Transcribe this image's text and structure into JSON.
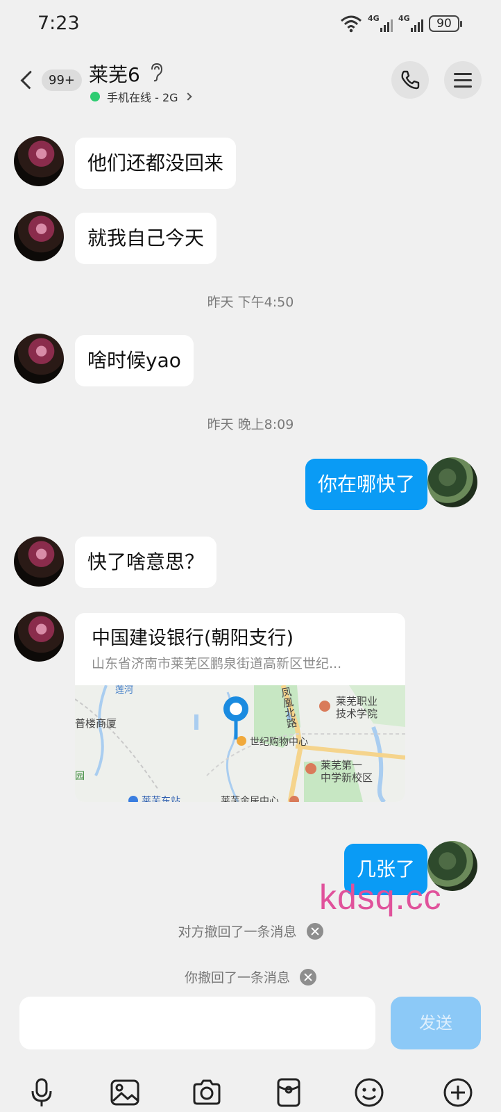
{
  "status_bar": {
    "time": "7:23",
    "signal1_label": "4G",
    "signal2_label": "4G",
    "battery": "90"
  },
  "header": {
    "unread_badge": "99+",
    "contact_name": "莱芜6",
    "online_status": "手机在线 - 2G"
  },
  "messages": [
    {
      "side": "in",
      "text": "他们还都没回来"
    },
    {
      "side": "in",
      "text": "就我自己今天"
    },
    {
      "side": "time",
      "text": "昨天 下午4:50"
    },
    {
      "side": "in",
      "text": "啥时候yao"
    },
    {
      "side": "time",
      "text": "昨天 晚上8:09"
    },
    {
      "side": "out",
      "text": "你在哪快了"
    },
    {
      "side": "in",
      "text": "快了啥意思？"
    },
    {
      "side": "in",
      "type": "location",
      "title": "中国建设银行(朝阳支行)",
      "address": "山东省济南市莱芜区鹏泉街道高新区世纪..."
    },
    {
      "side": "out",
      "text": "几张了"
    }
  ],
  "map_labels": {
    "road1": "凤凰北路",
    "school1": "莱芜职业技术学院",
    "school1_line1": "莱芜职业",
    "school1_line2": "技术学院",
    "mall": "世纪购物中心",
    "school2_line1": "莱芜第一",
    "school2_line2": "中学新校区",
    "building": "普楼商厦",
    "station": "莱芜东站",
    "home_center": "莱芜金居中心",
    "river": "莲河",
    "park": "园"
  },
  "recalls": {
    "other": "对方撤回了一条消息",
    "self": "你撤回了一条消息"
  },
  "watermark": "kdsq.cc",
  "input": {
    "placeholder": "",
    "send_label": "发送"
  },
  "toolbar_icons": [
    "microphone-icon",
    "image-icon",
    "camera-icon",
    "red-packet-icon",
    "emoji-icon",
    "plus-icon"
  ],
  "colors": {
    "bubble_out": "#0a9bf5",
    "bubble_in": "#ffffff",
    "background": "#f0f0f0",
    "send_button": "#8cc9f7",
    "online_dot": "#2ecc71",
    "watermark": "#e0529b"
  }
}
